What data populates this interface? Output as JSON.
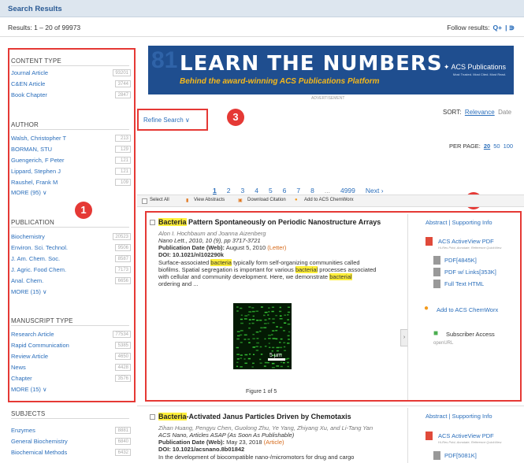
{
  "header": {
    "title": "Search Results"
  },
  "results_line": "Results: 1 – 20 of 99973",
  "follow": {
    "label": "Follow results:",
    "icons": [
      "subscribe-plus-icon",
      "rss-icon"
    ]
  },
  "sidebar": {
    "sections": [
      {
        "title": "CONTENT TYPE",
        "items": [
          {
            "label": "Journal Article",
            "count": "93201"
          },
          {
            "label": "C&EN Article",
            "count": "3744"
          },
          {
            "label": "Book Chapter",
            "count": "2847"
          }
        ]
      },
      {
        "title": "AUTHOR",
        "items": [
          {
            "label": "Walsh, Christopher T",
            "count": "213"
          },
          {
            "label": "BORMAN, STU",
            "count": "129"
          },
          {
            "label": "Guengerich, F Peter",
            "count": "121"
          },
          {
            "label": "Lippard, Stephen J",
            "count": "121"
          },
          {
            "label": "Raushel, Frank M",
            "count": "109"
          }
        ],
        "more": "MORE (95) ∨"
      },
      {
        "title": "PUBLICATION",
        "items": [
          {
            "label": "Biochemistry",
            "count": "20523"
          },
          {
            "label": "Environ. Sci. Technol.",
            "count": "9506"
          },
          {
            "label": "J. Am. Chem. Soc.",
            "count": "8587"
          },
          {
            "label": "J. Agric. Food Chem.",
            "count": "7173"
          },
          {
            "label": "Anal. Chem.",
            "count": "6656"
          }
        ],
        "more": "MORE (15) ∨"
      },
      {
        "title": "MANUSCRIPT TYPE",
        "items": [
          {
            "label": "Research Article",
            "count": "77534"
          },
          {
            "label": "Rapid Communication",
            "count": "5385"
          },
          {
            "label": "Review Article",
            "count": "4650"
          },
          {
            "label": "News",
            "count": "4428"
          },
          {
            "label": "Chapter",
            "count": "3576"
          }
        ],
        "more": "MORE (15) ∨"
      },
      {
        "title": "SUBJECTS",
        "items": [
          {
            "label": "Enzymes",
            "count": "8881"
          },
          {
            "label": "General Biochemistry",
            "count": "6840"
          },
          {
            "label": "Biochemical Methods",
            "count": "6432"
          }
        ]
      }
    ]
  },
  "annotations": {
    "one": "1",
    "two": "2",
    "three": "3"
  },
  "banner": {
    "headline": "LEARN THE NUMBERS",
    "subline": "Behind the award-winning ACS Publications Platform",
    "logo": "ACS Publications",
    "tagline": "Most Trusted. Most Cited. Most Read.",
    "ad_label": "ADVERTISEMENT"
  },
  "refine": {
    "label": "Refine Search ∨"
  },
  "sort": {
    "label": "SORT:",
    "options": [
      "Relevance",
      "Date"
    ]
  },
  "per_page": {
    "label": "PER PAGE:",
    "options": [
      "20",
      "50",
      "100"
    ]
  },
  "pagination": {
    "pages": [
      "1",
      "2",
      "3",
      "4",
      "5",
      "6",
      "7",
      "8",
      "...",
      "4999"
    ],
    "next": "Next ›"
  },
  "toolbar": {
    "select_all": "Select All",
    "view_abstracts": "View Abstracts",
    "download_citation": "Download Citation",
    "add_chemworx": "Add to ACS ChemWorx"
  },
  "result1": {
    "title_hl": "Bacteria",
    "title_rest": " Pattern Spontaneously on Periodic Nanostructure Arrays",
    "authors": "Alon I. Hochbaum and Joanna Aizenberg",
    "citation": "Nano Lett., 2010, 10 (9), pp 3717-3721",
    "pub_date_label": "Publication Date (Web):",
    "pub_date": " August 5, 2010 ",
    "pub_type": "(Letter)",
    "doi": "DOI: 10.1021/nl102290k",
    "abstract_l1a": "Surface-associated ",
    "abstract_hl1": "bacteria",
    "abstract_l1b": " typically form self-organizing communities called",
    "abstract_l2a": "biofilms. Spatial segregation is important for various ",
    "abstract_hl2": "bacterial",
    "abstract_l2b": " processes associated",
    "abstract_l3a": "with cellular and community development. Here, we demonstrate ",
    "abstract_hl3": "bacterial",
    "abstract_l4": "ordering and ...",
    "figure_caption": "Figure 1 of 5",
    "scale_text": "5 µm",
    "side_links": {
      "abstract": "Abstract | Supporting Info",
      "activeview": "ACS ActiveView PDF",
      "activeview_sub": "Hi-Res Print, Annotate, Reference QuickView",
      "pdf": "PDF[4845K]",
      "pdf_links": "PDF w/ Links[353K]",
      "fulltext": "Full Text HTML",
      "chemworx": "Add to ACS ChemWorx",
      "subscriber": "Subscriber Access",
      "openurl": "openURL"
    }
  },
  "result2": {
    "title_hl": "Bacteria",
    "title_rest": "-Activated Janus Particles Driven by Chemotaxis",
    "authors": "Zihan Huang, Pengyu Chen, Guolong Zhu, Ye Yang, Zhiyang Xu, and Li-Tang Yan",
    "citation": "ACS Nano, Articles ASAP (As Soon As Publishable)",
    "pub_date_label": "Publication Date (Web):",
    "pub_date": " May 23, 2018 ",
    "pub_type": "(Article)",
    "doi": "DOI: 10.1021/acsnano.8b01842",
    "abstract": "In the development of biocompatible nano-/micromotors for drug and cargo",
    "side_links": {
      "abstract": "Abstract | Supporting Info",
      "activeview": "ACS ActiveView PDF",
      "activeview_sub": "Hi-Res Print, Annotate, Reference QuickView",
      "pdf": "PDF[5081K]"
    }
  },
  "colors": {
    "accent": "#2a6ebb",
    "annotation_red": "#e53935",
    "highlight": "#ffef3a"
  }
}
